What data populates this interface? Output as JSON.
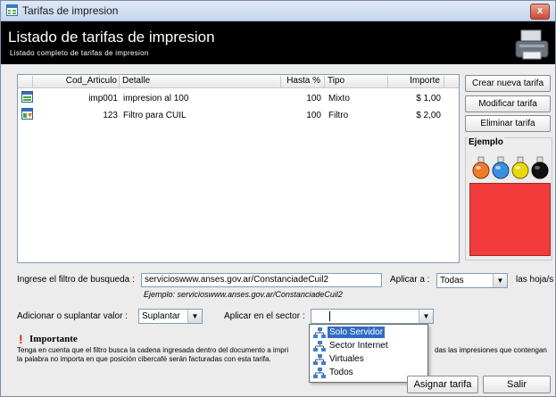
{
  "window": {
    "title": "Tarifas de impresion",
    "close_glyph": "x"
  },
  "banner": {
    "title": "Listado de tarifas de impresion",
    "subtitle": "Listado completo de tarifas de impresion"
  },
  "table": {
    "columns": [
      "Cod_Articulo",
      "Detalle",
      "Hasta %",
      "Tipo",
      "Importe"
    ],
    "rows": [
      {
        "icon": "tariff-mixed-icon",
        "cod": "imp001",
        "detalle": "impresion al 100",
        "hasta": "100",
        "tipo": "Mixto",
        "importe": "$ 1,00"
      },
      {
        "icon": "tariff-filter-icon",
        "cod": "123",
        "detalle": "Filtro para CUIL",
        "hasta": "100",
        "tipo": "Filtro",
        "importe": "$ 2,00"
      }
    ]
  },
  "side_buttons": {
    "create": "Crear nueva tarifa",
    "modify": "Modificar tarifa",
    "delete": "Eliminar tarifa"
  },
  "example": {
    "label": "Ejemplo",
    "flask_colors": [
      "#f07a2a",
      "#3a8fe0",
      "#e8d80a",
      "#111111"
    ],
    "swatch_color": "#f23b3b"
  },
  "filter": {
    "label": "Ingrese el filtro de busqueda :",
    "value": "servicioswww.anses.gov.ar/ConstanciadeCuil2",
    "hint": "Ejemplo: servicioswww.anses.gov.ar/ConstanciadeCuil2",
    "apply_label": "Aplicar a :",
    "apply_value": "Todas",
    "apply_suffix": "las hoja/s"
  },
  "mode": {
    "label": "Adicionar o suplantar valor :",
    "value": "Suplantar"
  },
  "sector": {
    "label": "Aplicar en el sector :",
    "value": "",
    "options": [
      "Solo Servidor",
      "Sector Internet",
      "Virtuales",
      "Todos"
    ],
    "highlighted": "Solo Servidor"
  },
  "important": {
    "title": "Importante",
    "text_line1": "Tenga en cuenta que el filtro busca la cadena ingresada dentro del documento a impri",
    "text_line1_end": "das las impresiones que contengan",
    "text_line2": "la palabra no importa en que posición cibercafé serán facturadas con esta tarifa."
  },
  "footer": {
    "assign": "Asignar tarifa",
    "exit": "Salir"
  }
}
